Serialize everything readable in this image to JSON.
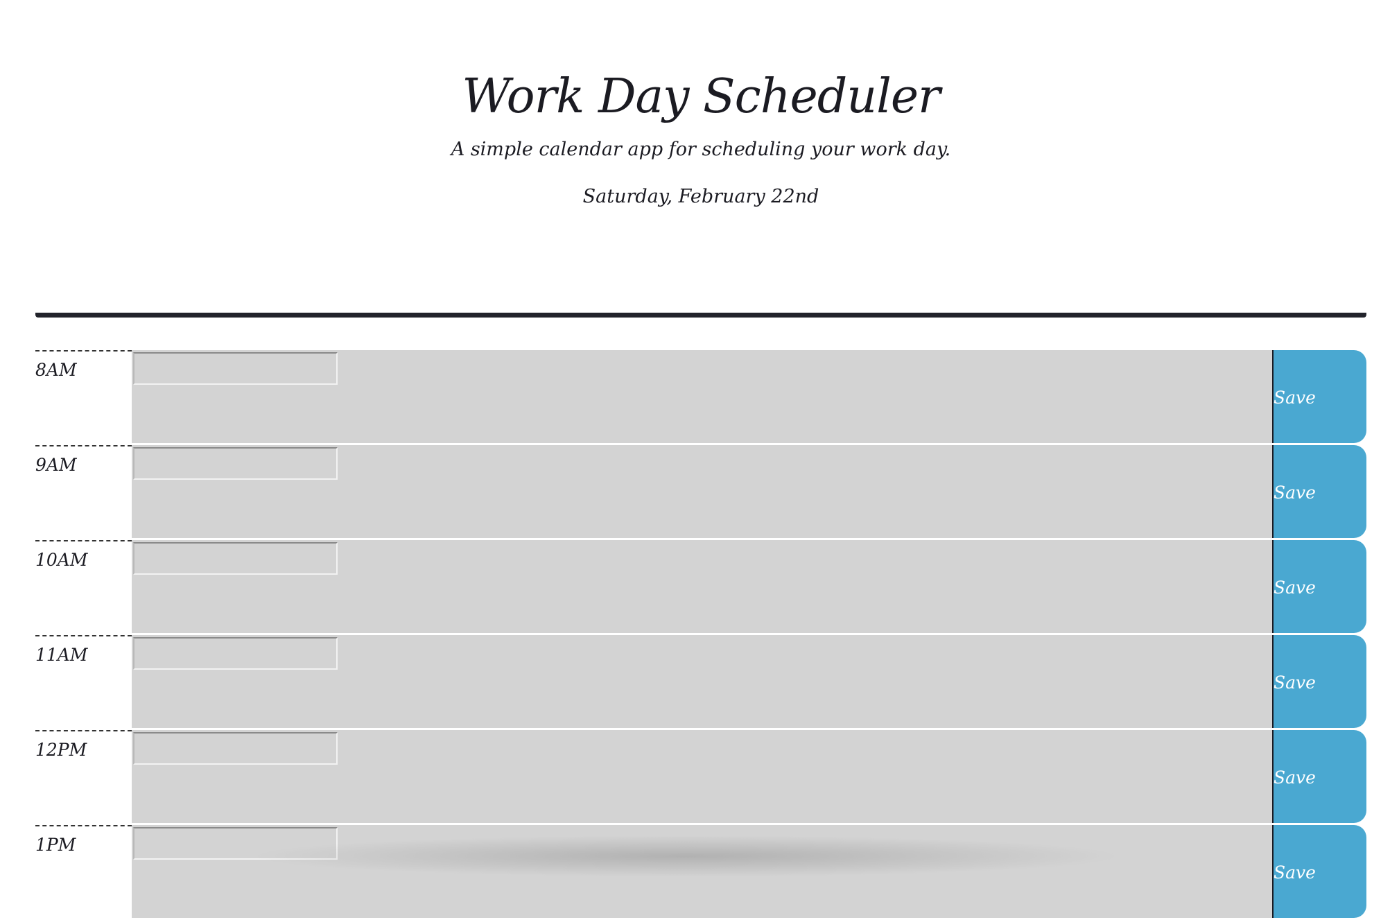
{
  "header": {
    "title": "Work Day Scheduler",
    "subtitle": "A simple calendar app for scheduling your work day.",
    "current_day": "Saturday, February 22nd"
  },
  "schedule": {
    "rows": [
      {
        "hour": "8AM",
        "event_value": "",
        "save_label": "Save"
      },
      {
        "hour": "9AM",
        "event_value": "",
        "save_label": "Save"
      },
      {
        "hour": "10AM",
        "event_value": "",
        "save_label": "Save"
      },
      {
        "hour": "11AM",
        "event_value": "",
        "save_label": "Save"
      },
      {
        "hour": "12PM",
        "event_value": "",
        "save_label": "Save"
      },
      {
        "hour": "1PM",
        "event_value": "",
        "save_label": "Save"
      }
    ]
  },
  "colors": {
    "past_block": "#d3d3d3",
    "save_button": "#4aa8d1",
    "header_rule": "#22232b"
  },
  "icons": []
}
